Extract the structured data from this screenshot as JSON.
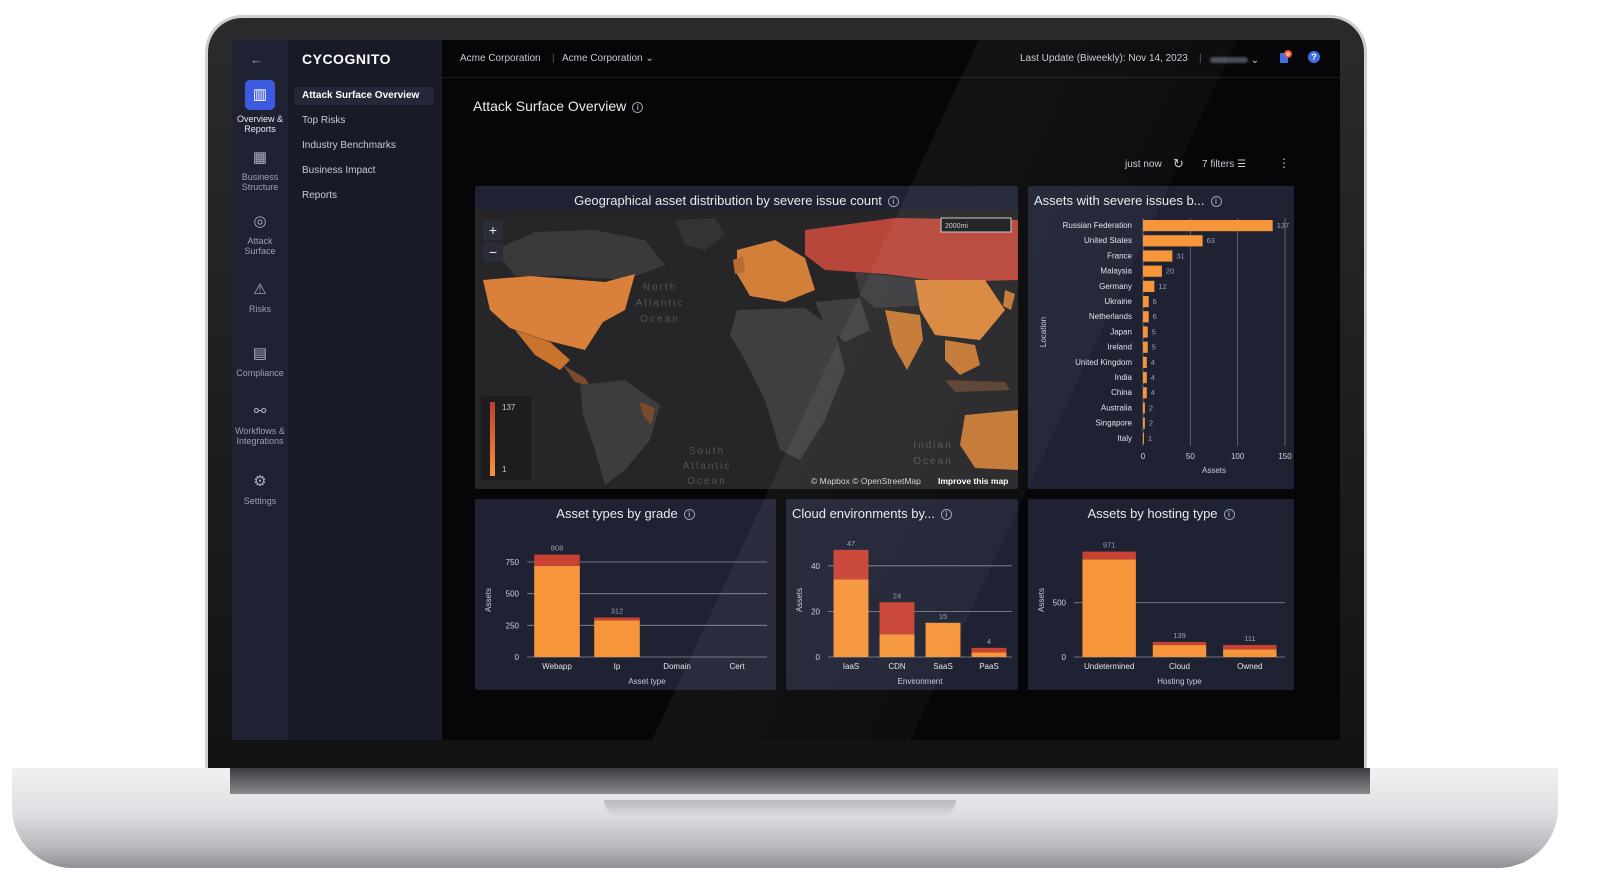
{
  "app": {
    "logo": "CYCOGNITO",
    "back_icon": "←"
  },
  "rail": {
    "items": [
      {
        "id": "overview",
        "label_1": "Overview &",
        "label_2": "Reports",
        "icon": "bar-chart-icon",
        "glyph": "▥",
        "active": true
      },
      {
        "id": "business",
        "label_1": "Business",
        "label_2": "Structure",
        "icon": "building-icon",
        "glyph": "▦",
        "active": false
      },
      {
        "id": "attack",
        "label_1": "Attack",
        "label_2": "Surface",
        "icon": "radar-icon",
        "glyph": "◎",
        "active": false
      },
      {
        "id": "risks",
        "label_1": "Risks",
        "label_2": "",
        "icon": "warning-icon",
        "glyph": "⚠",
        "active": false
      },
      {
        "id": "compliance",
        "label_1": "Compliance",
        "label_2": "",
        "icon": "document-check-icon",
        "glyph": "▤",
        "active": false
      },
      {
        "id": "workflows",
        "label_1": "Workflows &",
        "label_2": "Integrations",
        "icon": "link-icon",
        "glyph": "⚯",
        "active": false
      },
      {
        "id": "settings",
        "label_1": "Settings",
        "label_2": "",
        "icon": "gear-icon",
        "glyph": "⚙",
        "active": false
      }
    ]
  },
  "nav": {
    "items": [
      {
        "label": "Attack Surface Overview",
        "active": true
      },
      {
        "label": "Top Risks",
        "active": false
      },
      {
        "label": "Industry Benchmarks",
        "active": false
      },
      {
        "label": "Business Impact",
        "active": false
      },
      {
        "label": "Reports",
        "active": false
      }
    ]
  },
  "topbar": {
    "org_1": "Acme Corporation",
    "org_2": "Acme Corporation",
    "last_update": "Last Update (Biweekly): Nov 14, 2023"
  },
  "page": {
    "title": "Attack Surface Overview",
    "refresh_label": "just now",
    "filters_label": "7 filters"
  },
  "colors": {
    "bar_main": "#f6953a",
    "bar_severe": "#c84233",
    "panel": "#1f2233",
    "accent": "#3d5be0"
  },
  "map_card": {
    "title": "Geographical asset distribution by severe issue count",
    "legend_max": "137",
    "legend_min": "1",
    "attribution_1": "© Mapbox © OpenStreetMap",
    "attribution_2": "Improve this map",
    "scale_label": "2000mi",
    "ocean_labels": [
      "North Atlantic Ocean",
      "South Atlantic Ocean",
      "Indian Ocean"
    ]
  },
  "chart_data": [
    {
      "id": "severe_by_location",
      "type": "bar",
      "orientation": "horizontal",
      "title": "Assets with severe issues b...",
      "ylabel": "Location",
      "xlabel": "Assets",
      "xlim": [
        0,
        150
      ],
      "xticks": [
        0,
        50,
        100,
        150
      ],
      "grid": true,
      "categories": [
        "Russian Federation",
        "United States",
        "France",
        "Malaysia",
        "Germany",
        "Ukraine",
        "Netherlands",
        "Japan",
        "Ireland",
        "United Kingdom",
        "India",
        "China",
        "Australia",
        "Singapore",
        "Italy"
      ],
      "values": [
        137,
        63,
        31,
        20,
        12,
        6,
        6,
        5,
        5,
        4,
        4,
        4,
        2,
        2,
        1
      ]
    },
    {
      "id": "asset_types_by_grade",
      "type": "bar",
      "stacked": true,
      "title": "Asset types by grade",
      "xlabel": "Asset type",
      "ylabel": "Assets",
      "ylim": [
        0,
        900
      ],
      "yticks": [
        0,
        250,
        500,
        750
      ],
      "grid": true,
      "categories": [
        "Webapp",
        "Ip",
        "Domain",
        "Cert"
      ],
      "totals": [
        808,
        312,
        0,
        0
      ],
      "series": [
        {
          "values": [
            720,
            290,
            0,
            0
          ]
        },
        {
          "values": [
            88,
            22,
            0,
            0
          ]
        }
      ]
    },
    {
      "id": "cloud_environments",
      "type": "bar",
      "stacked": true,
      "title": "Cloud environments by...",
      "xlabel": "Environment",
      "ylabel": "Assets",
      "ylim": [
        0,
        50
      ],
      "yticks": [
        0,
        20,
        40
      ],
      "grid": true,
      "categories": [
        "IaaS",
        "CDN",
        "SaaS",
        "PaaS"
      ],
      "totals": [
        47,
        24,
        15,
        4
      ],
      "series": [
        {
          "values": [
            34,
            10,
            15,
            2
          ]
        },
        {
          "values": [
            13,
            14,
            0,
            2
          ]
        }
      ]
    },
    {
      "id": "assets_by_hosting",
      "type": "bar",
      "stacked": true,
      "title": "Assets by hosting type",
      "xlabel": "Hosting type",
      "ylabel": "Assets",
      "ylim": [
        0,
        1050
      ],
      "yticks": [
        0,
        500
      ],
      "grid": true,
      "categories": [
        "Undetermined",
        "Cloud",
        "Owned"
      ],
      "totals": [
        971,
        139,
        111
      ],
      "series": [
        {
          "values": [
            900,
            110,
            70
          ]
        },
        {
          "values": [
            71,
            29,
            41
          ]
        }
      ]
    }
  ]
}
